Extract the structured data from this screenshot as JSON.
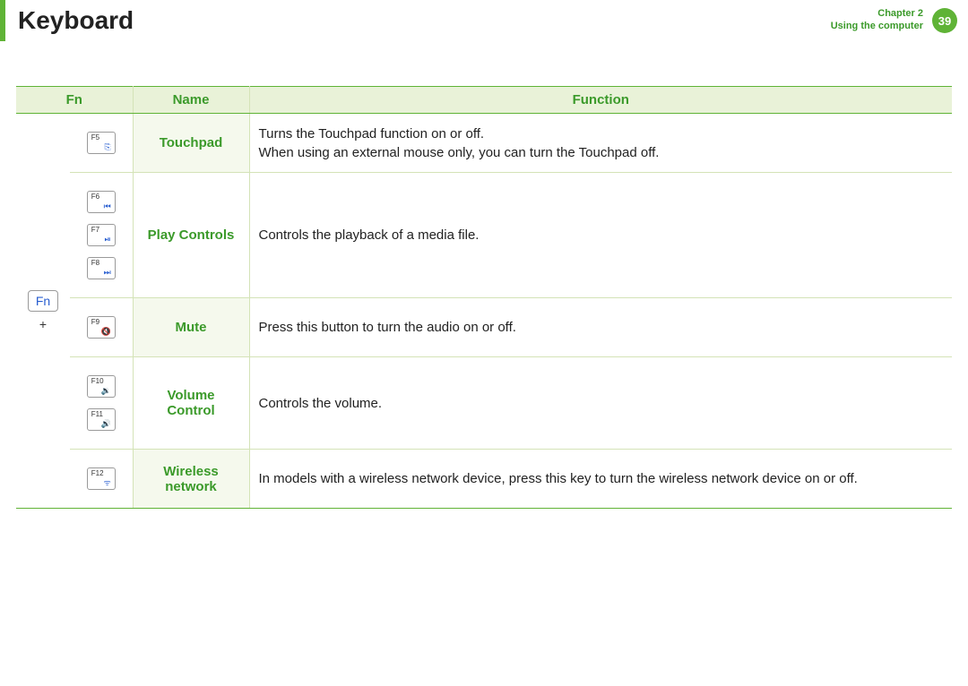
{
  "header": {
    "title": "Keyboard",
    "chapter_line1": "Chapter 2",
    "chapter_line2": "Using the computer",
    "page_number": "39"
  },
  "table": {
    "headers": {
      "fn": "Fn",
      "name": "Name",
      "function": "Function"
    },
    "fn_key_label": "Fn",
    "plus": "+",
    "rows": [
      {
        "keys": [
          {
            "label": "F5",
            "icon": "⎘"
          }
        ],
        "name": "Touchpad",
        "function": "Turns the Touchpad function on or off.\nWhen using an external mouse only, you can turn the Touchpad off."
      },
      {
        "keys": [
          {
            "label": "F6",
            "icon": "⏮"
          },
          {
            "label": "F7",
            "icon": "⏯"
          },
          {
            "label": "F8",
            "icon": "⏭"
          }
        ],
        "name": "Play Controls",
        "function": "Controls the playback of a media file."
      },
      {
        "keys": [
          {
            "label": "F9",
            "icon": "🔇"
          }
        ],
        "name": "Mute",
        "function": "Press this button to turn the audio on or off."
      },
      {
        "keys": [
          {
            "label": "F10",
            "icon": "🔉"
          },
          {
            "label": "F11",
            "icon": "🔊"
          }
        ],
        "name": "Volume Control",
        "function": "Controls the volume."
      },
      {
        "keys": [
          {
            "label": "F12",
            "icon": "ᯤ"
          }
        ],
        "name": "Wireless network",
        "function": "In models with a wireless network device, press this key to turn the wireless network device on or off."
      }
    ]
  }
}
